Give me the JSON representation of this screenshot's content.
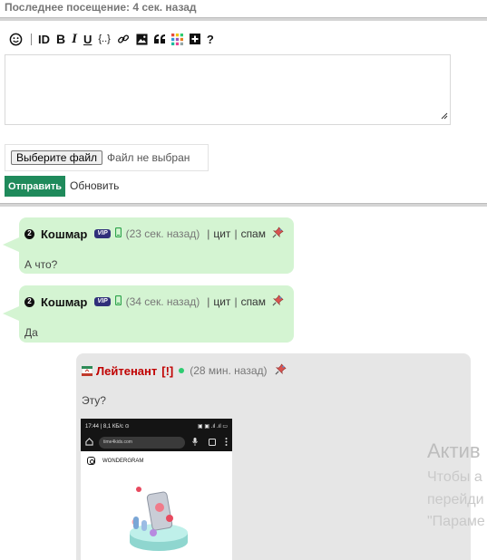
{
  "header": {
    "last_visit": "Последнее посещение: 4 сек. назад"
  },
  "toolbar": {
    "smiley": "smiley-icon",
    "id_label": "ID",
    "bold_label": "B",
    "italic_label": "I",
    "underline_label": "U",
    "code_label": "{..}",
    "quote_label": "\"",
    "help_label": "?"
  },
  "form": {
    "file_button": "Выберите файл",
    "file_status": "Файл не выбран",
    "submit_label": "Отправить",
    "refresh_label": "Обновить"
  },
  "posts": [
    {
      "user": "Кошмар",
      "badge": "VIP",
      "level_icon": "2",
      "time": "(23 сек. назад)",
      "actions": [
        "цит",
        "спам"
      ],
      "text": "А что?"
    },
    {
      "user": "Кошмар",
      "badge": "VIP",
      "level_icon": "2",
      "time": "(34 сек. назад)",
      "actions": [
        "цит",
        "спам"
      ],
      "text": "Да"
    },
    {
      "user": "Лейтенант",
      "mark": "[!]",
      "time": "(28 мин. назад)",
      "text": "Эту?",
      "screenshot": {
        "status_left": "17:44 | 8,1 КБ/с ⊙",
        "status_right": "▣ ▣ .ıl .ıl ▭",
        "url": "time4kids.com",
        "brand": "WONDERGRAM"
      }
    }
  ],
  "watermark": {
    "line1": "Актив",
    "line2": "Чтобы а",
    "line3": "перейди",
    "line4": "\"Параме"
  },
  "colors": {
    "accent": "#1f8a5b",
    "bubble": "#d4f4d2",
    "card": "#e6e6e6",
    "lieutenant": "#c00000"
  }
}
